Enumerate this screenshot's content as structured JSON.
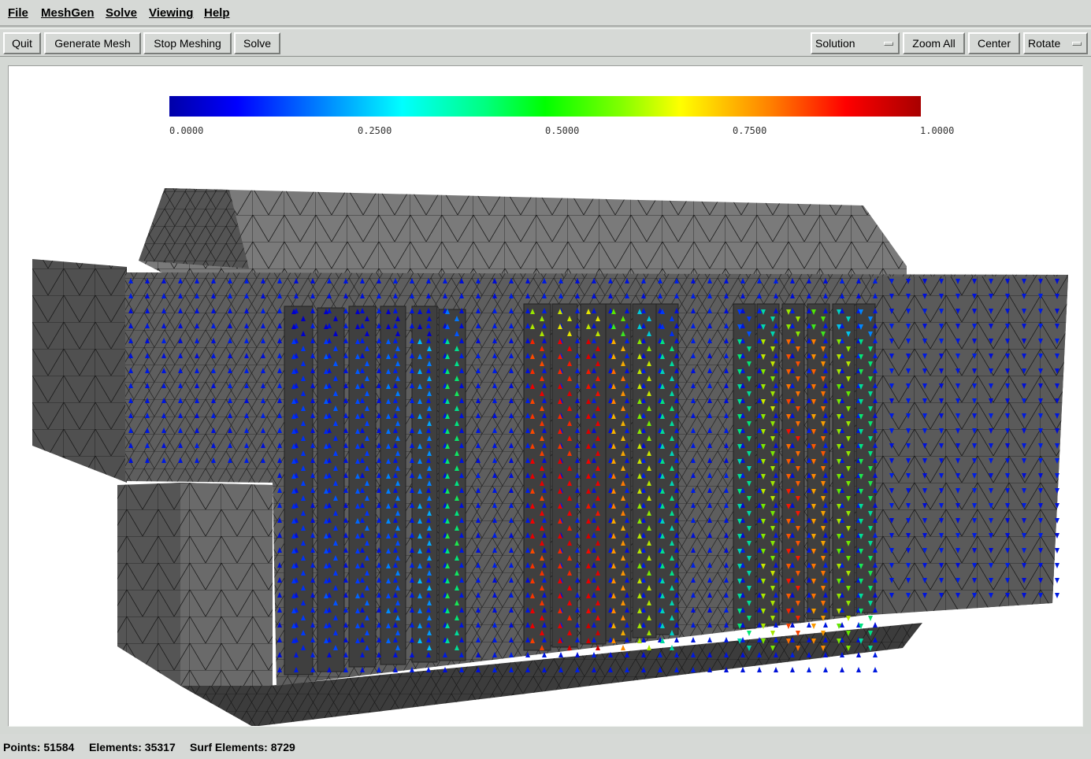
{
  "menubar": {
    "items": [
      "File",
      "MeshGen",
      "Solve",
      "Viewing",
      "Help"
    ]
  },
  "toolbar": {
    "quit": "Quit",
    "generate_mesh": "Generate Mesh",
    "stop_meshing": "Stop Meshing",
    "solve": "Solve",
    "view_mode_select": "Solution",
    "zoom_all": "Zoom All",
    "center": "Center",
    "mouse_mode_select": "Rotate"
  },
  "colorbar": {
    "labels": [
      "0.0000",
      "0.2500",
      "0.5000",
      "0.7500",
      "1.0000"
    ],
    "colors": [
      "#0000a8",
      "#0000ff",
      "#00ffff",
      "#00ff00",
      "#ffff00",
      "#ff0000",
      "#a80000"
    ]
  },
  "status": {
    "points": "Points: 51584",
    "elements": "Elements: 35317",
    "surf_elements": "Surf Elements: 8729"
  }
}
